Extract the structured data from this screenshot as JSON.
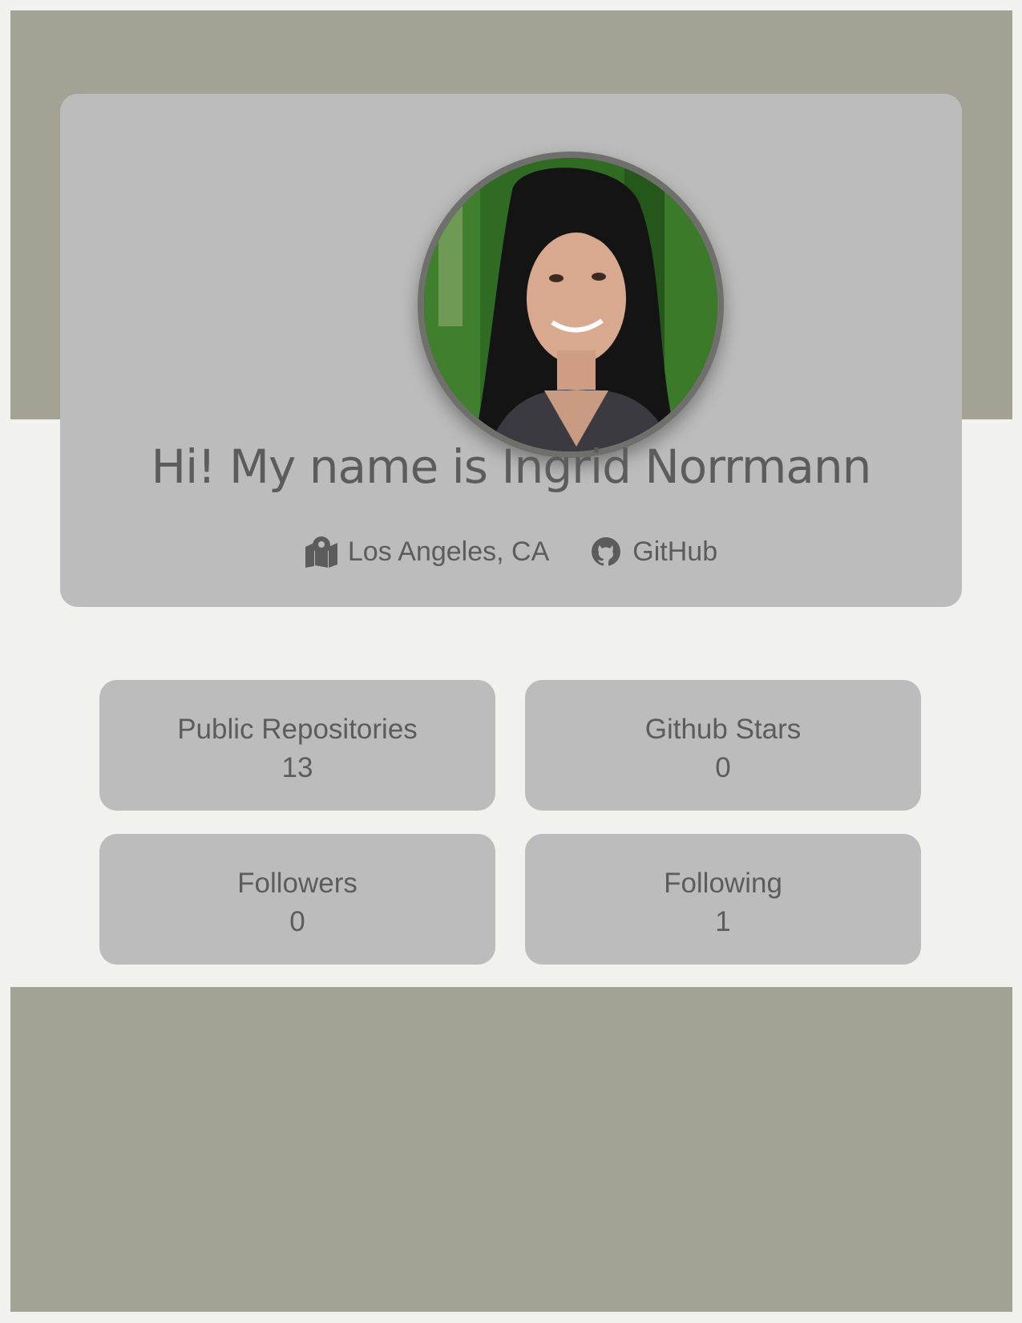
{
  "profile": {
    "greeting": "Hi! My name is Ingrid Norrmann",
    "location": "Los Angeles, CA",
    "github_label": "GitHub",
    "location_icon": "map-marker-icon",
    "github_icon": "github-icon",
    "avatar_alt": "Ingrid Norrmann"
  },
  "stats": [
    {
      "label": "Public Repositories",
      "value": "13"
    },
    {
      "label": "Github Stars",
      "value": "0"
    },
    {
      "label": "Followers",
      "value": "0"
    },
    {
      "label": "Following",
      "value": "1"
    }
  ],
  "colors": {
    "page_background": "#f1f1ee",
    "band": "#a3a294",
    "card": "#bcbcbc",
    "text": "#5c5c5c",
    "avatar_border": "#6f6f6b"
  }
}
